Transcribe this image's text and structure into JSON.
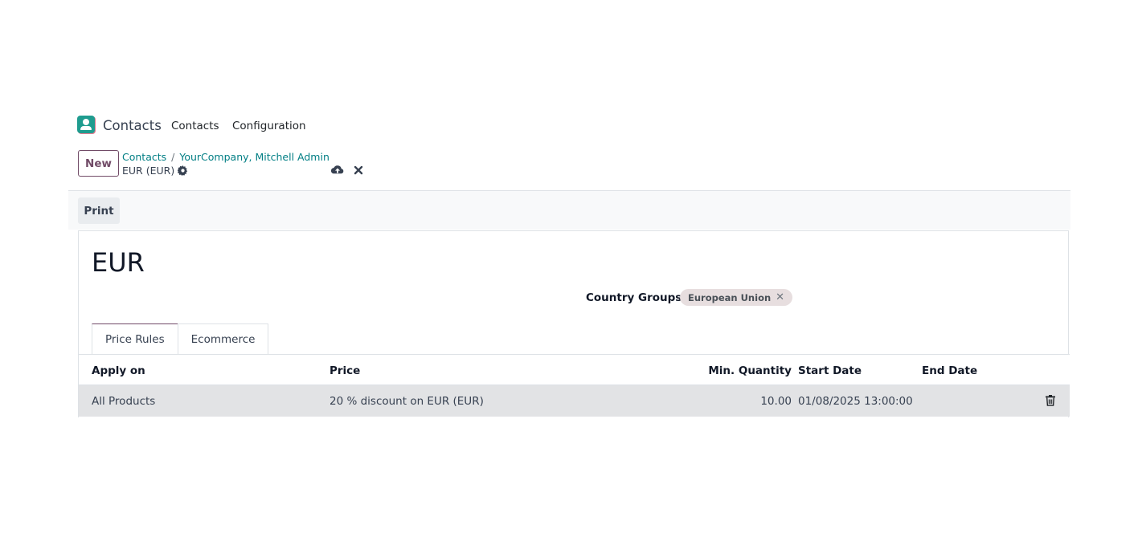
{
  "navbar": {
    "app_name": "Contacts",
    "menu": [
      "Contacts",
      "Configuration"
    ]
  },
  "control_panel": {
    "new_label": "New",
    "breadcrumbs": [
      "Contacts",
      "YourCompany, Mitchell Admin"
    ],
    "breadcrumb_separator": "/",
    "record_name": "EUR (EUR)"
  },
  "action_bar": {
    "print_label": "Print"
  },
  "form": {
    "title": "EUR",
    "country_groups_label": "Country Groups",
    "country_groups_tags": [
      "European Union"
    ]
  },
  "tabs": [
    {
      "label": "Price Rules",
      "active": true
    },
    {
      "label": "Ecommerce",
      "active": false
    }
  ],
  "price_rules": {
    "columns": [
      "Apply on",
      "Price",
      "Min. Quantity",
      "Start Date",
      "End Date"
    ],
    "rows": [
      {
        "apply_on": "All Products",
        "price": "20 % discount on EUR (EUR)",
        "min_quantity": "10.00",
        "start_date": "01/08/2025 13:00:00",
        "end_date": ""
      }
    ]
  },
  "colors": {
    "brand": "#714b67",
    "link": "#017e84",
    "app_icon": "#1f9c8f",
    "tag_bg": "#e7dedf",
    "row_highlight": "#e2e3e5"
  }
}
